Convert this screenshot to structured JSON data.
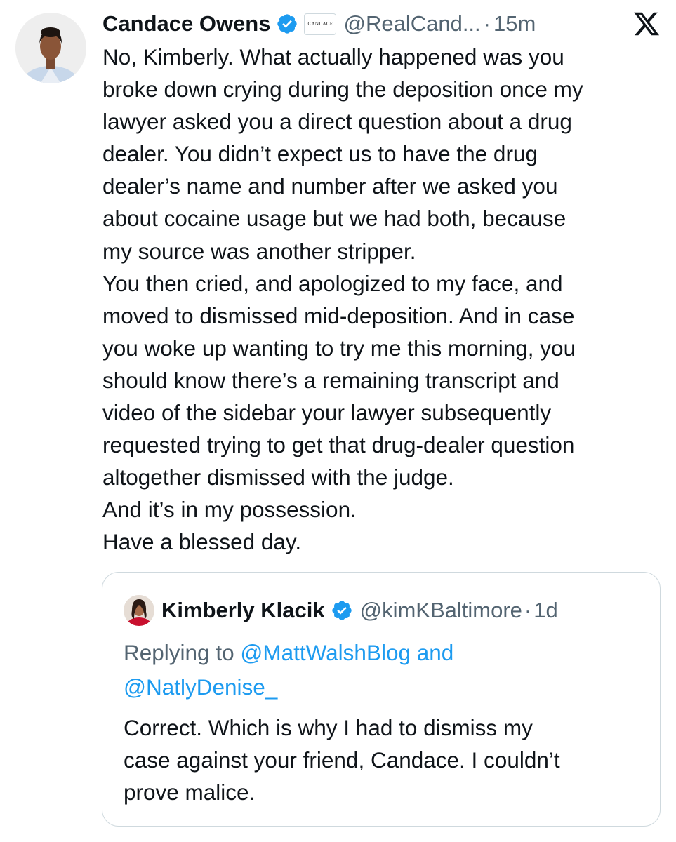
{
  "tweet": {
    "author": {
      "name": "Candace Owens",
      "handle": "@RealCand...",
      "affiliate_badge": "CANDACE",
      "verified": true,
      "avatar_icon": "profile-photo"
    },
    "separator": "·",
    "time": "15m",
    "platform_icon": "x-logo-icon",
    "lines": [
      "No, Kimberly. What actually happened was you",
      "broke down crying during the deposition once my",
      "lawyer asked you a direct question about a drug",
      "dealer. You didn’t expect us to have the drug",
      "dealer’s name and number after we asked you",
      "about cocaine usage but we had both, because",
      "my source was another stripper.",
      "You then cried, and apologized to my face, and",
      "moved to dismissed mid-deposition. And in case",
      "you woke up wanting to try me this morning, you",
      "should know there’s a remaining transcript and",
      "video of the sidebar your lawyer subsequently",
      "requested trying to get that drug-dealer question",
      "altogether dismissed with the judge.",
      "And it’s in my possession.",
      "Have a blessed day."
    ]
  },
  "quoted_tweet": {
    "author": {
      "name": "Kimberly Klacik",
      "handle": "@kimKBaltimore",
      "verified": true,
      "avatar_icon": "profile-photo"
    },
    "separator": "·",
    "time": "1d",
    "replying": {
      "prefix": "Replying to ",
      "mention1": "@MattWalshBlog",
      "conjunction": " and",
      "mention2": "@NatlyDenise_"
    },
    "lines": [
      "Correct. Which is why I had to dismiss my",
      "case against your friend, Candace. I couldn’t",
      "prove malice."
    ]
  },
  "colors": {
    "text": "#0f1419",
    "secondary": "#536471",
    "link": "#1d9bf0",
    "verified": "#1d9bf0",
    "border": "#cfd9de"
  }
}
